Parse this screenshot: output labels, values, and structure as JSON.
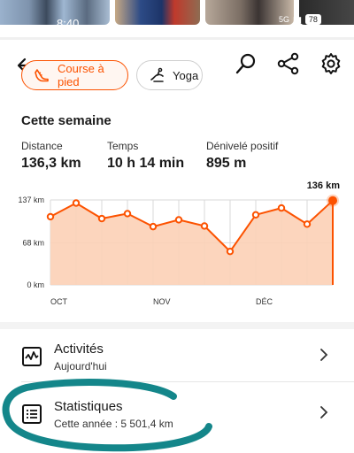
{
  "status_bar": {
    "time": "8:40",
    "network": "5G",
    "battery": "78"
  },
  "colors": {
    "accent": "#fc5200",
    "area_fill": "#fcd0b6",
    "annotation": "#14868a"
  },
  "sport_chips": [
    {
      "label": "Course à pied",
      "icon": "running-shoe-icon",
      "selected": true
    },
    {
      "label": "Yoga",
      "icon": "yoga-icon",
      "selected": false
    }
  ],
  "toolbar_icons": [
    "back-arrow-icon",
    "search-icon",
    "share-icon",
    "gear-icon"
  ],
  "week": {
    "title": "Cette semaine",
    "stats": [
      {
        "label": "Distance",
        "value": "136,3 km"
      },
      {
        "label": "Temps",
        "value": "10 h 14 min"
      },
      {
        "label": "Dénivelé positif",
        "value": "895 m"
      }
    ]
  },
  "chart_data": {
    "type": "area",
    "y_tick_labels": [
      "137 km",
      "68 km",
      "0 km"
    ],
    "y_ticks": [
      137,
      68,
      0
    ],
    "ylim": [
      0,
      137
    ],
    "x_tick_labels": [
      "OCT",
      "NOV",
      "DÉC"
    ],
    "x_tick_index": [
      0,
      4,
      8
    ],
    "values": [
      110,
      132,
      107,
      115,
      94,
      105,
      95,
      54,
      113,
      124,
      98,
      136
    ],
    "highlight_label": "136 km",
    "grid": true
  },
  "rows": [
    {
      "title": "Activités",
      "subtitle": "Aujourd'hui",
      "icon": "activity-chart-icon"
    },
    {
      "title": "Statistiques",
      "subtitle": "Cette année : 5 501,4 km",
      "icon": "stats-list-icon"
    }
  ]
}
